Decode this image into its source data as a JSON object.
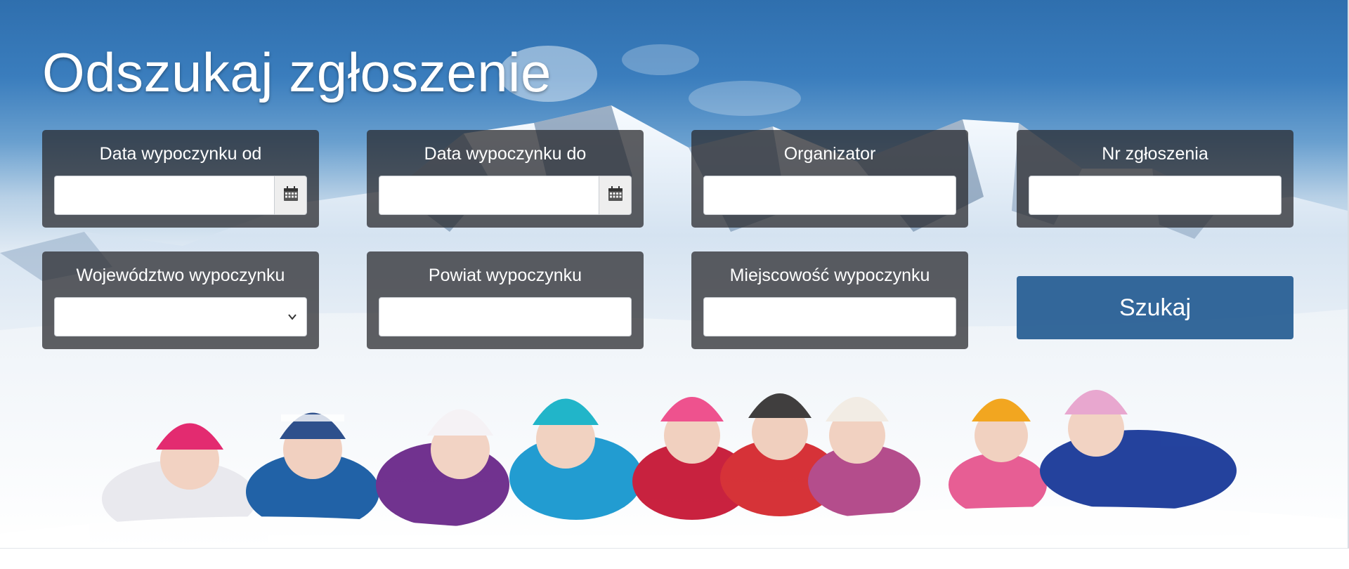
{
  "page_title": "Odszukaj zgłoszenie",
  "filters": {
    "date_from": {
      "label": "Data wypoczynku od",
      "value": "",
      "icon": "calendar-icon"
    },
    "date_to": {
      "label": "Data wypoczynku do",
      "value": "",
      "icon": "calendar-icon"
    },
    "organizer": {
      "label": "Organizator",
      "value": ""
    },
    "application_number": {
      "label": "Nr zgłoszenia",
      "value": ""
    },
    "voivodeship": {
      "label": "Województwo wypoczynku",
      "selected": "",
      "icon": "chevron-down-icon"
    },
    "county": {
      "label": "Powiat wypoczynku",
      "value": ""
    },
    "locality": {
      "label": "Miejscowość wypoczynku",
      "value": ""
    }
  },
  "search_button": {
    "label": "Szukaj"
  },
  "colors": {
    "panel_background": "#28282c",
    "button_background": "#265c92",
    "sky": "#2f6fae",
    "text": "#ffffff"
  }
}
